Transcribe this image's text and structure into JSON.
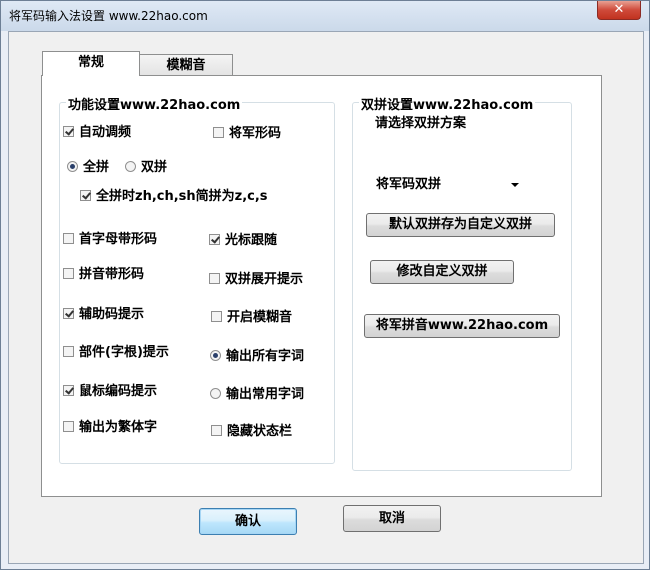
{
  "window": {
    "title": "将军码输入法设置 www.22hao.com",
    "close_label": "✕"
  },
  "tabs": [
    {
      "label": "常规"
    },
    {
      "label": "模糊音"
    }
  ],
  "left_group": {
    "title": "功能设置www.22hao.com",
    "auto_freq": {
      "label": "自动调频",
      "checked": true
    },
    "jiangjun_shape": {
      "label": "将军形码",
      "checked": false
    },
    "full_pinyin": {
      "label": "全拼",
      "selected": true
    },
    "double_pinyin": {
      "label": "双拼",
      "selected": false
    },
    "full_pinyin_abbrev": {
      "label": "全拼时zh,ch,sh简拼为z,c,s",
      "checked": true
    },
    "initial_shape": {
      "label": "首字母带形码",
      "checked": false
    },
    "cursor_follow": {
      "label": "光标跟随",
      "checked": true
    },
    "pinyin_shape": {
      "label": "拼音带形码",
      "checked": false
    },
    "double_expand_hint": {
      "label": "双拼展开提示",
      "checked": false
    },
    "aux_code_hint": {
      "label": "辅助码提示",
      "checked": true
    },
    "enable_fuzzy": {
      "label": "开启模糊音",
      "checked": false
    },
    "component_hint": {
      "label": "部件(字根)提示",
      "checked": false
    },
    "output_all_words": {
      "label": "输出所有字词",
      "selected": true
    },
    "mouse_code_hint": {
      "label": "鼠标编码提示",
      "checked": true
    },
    "output_common_words": {
      "label": "输出常用字词",
      "selected": false
    },
    "traditional_output": {
      "label": "输出为繁体字",
      "checked": false
    },
    "hide_status_bar": {
      "label": "隐藏状态栏",
      "checked": false
    }
  },
  "right_group": {
    "title": "双拼设置www.22hao.com",
    "prompt": "请选择双拼方案",
    "scheme_value": "将军码双拼",
    "save_custom_button": "默认双拼存为自定义双拼",
    "edit_custom_button": "修改自定义双拼",
    "jiangjun_pinyin_button": "将军拼音www.22hao.com"
  },
  "footer": {
    "ok_label": "确认",
    "cancel_label": "取消"
  }
}
